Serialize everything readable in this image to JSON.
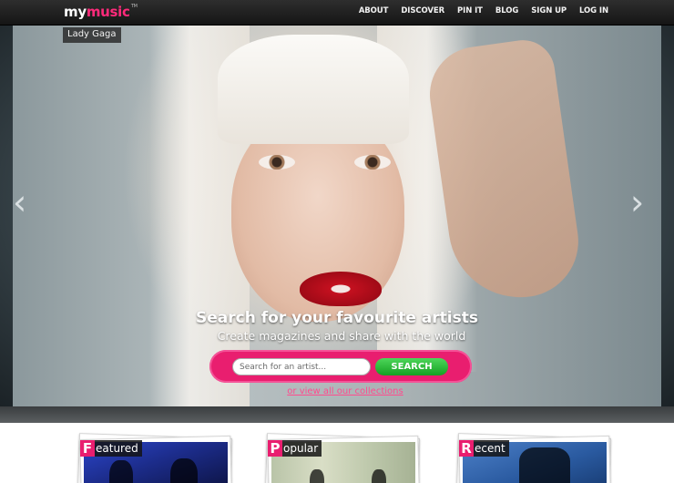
{
  "header": {
    "logo_my": "my",
    "logo_music": "music",
    "logo_tm": "TM",
    "nav": [
      {
        "label": "ABOUT"
      },
      {
        "label": "DISCOVER"
      },
      {
        "label": "PIN IT"
      },
      {
        "label": "BLOG"
      },
      {
        "label": "SIGN UP"
      },
      {
        "label": "LOG IN"
      }
    ]
  },
  "hero": {
    "caption": "Lady Gaga",
    "headline": "Search for your favourite artists",
    "subline": "Create magazines and share with the world",
    "search": {
      "placeholder": "Search for an artist...",
      "button_label": "SEARCH"
    },
    "collections_link": "or view all our collections",
    "prev_icon": "chevron-left-icon",
    "next_icon": "chevron-right-icon"
  },
  "sections": [
    {
      "initial": "F",
      "rest": "eatured"
    },
    {
      "initial": "P",
      "rest": "opular"
    },
    {
      "initial": "R",
      "rest": "ecent"
    }
  ],
  "colors": {
    "accent": "#e91e6f",
    "search_button": "#1faa2c",
    "nav_bg": "#1e1e1e"
  }
}
